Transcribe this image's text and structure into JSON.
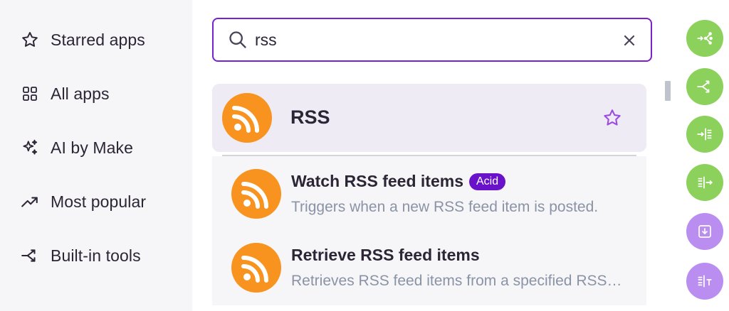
{
  "sidebar": {
    "items": [
      {
        "label": "Starred apps",
        "icon": "star-icon"
      },
      {
        "label": "All apps",
        "icon": "grid-icon"
      },
      {
        "label": "AI by Make",
        "icon": "sparkles-icon"
      },
      {
        "label": "Most popular",
        "icon": "trending-up-icon"
      },
      {
        "label": "Built-in tools",
        "icon": "split-arrows-icon"
      }
    ]
  },
  "search": {
    "value": "rss",
    "clear_icon": "close-icon"
  },
  "app": {
    "name": "RSS",
    "logo_color": "#f7931e",
    "favorite_icon": "star-outline-icon"
  },
  "modules": [
    {
      "title": "Watch RSS feed items",
      "badge": "Acid",
      "description": "Triggers when a new RSS feed item is posted."
    },
    {
      "title": "Retrieve RSS feed items",
      "badge": "",
      "description": "Retrieves RSS feed items from a specified RSS feed."
    }
  ],
  "tools": [
    {
      "icon": "router-icon",
      "color": "#8bd15c"
    },
    {
      "icon": "split-icon",
      "color": "#8bd15c"
    },
    {
      "icon": "aggregator-icon",
      "color": "#8bd15c"
    },
    {
      "icon": "iterator-icon",
      "color": "#8bd15c"
    },
    {
      "icon": "download-box-icon",
      "color": "#b98ef0"
    },
    {
      "icon": "text-aggregator-icon",
      "color": "#b98ef0"
    }
  ],
  "colors": {
    "accent": "#7b1fd1",
    "badge": "#6a12c9",
    "rss_orange": "#f7931e",
    "tool_green": "#8bd15c",
    "tool_purple": "#b98ef0"
  }
}
